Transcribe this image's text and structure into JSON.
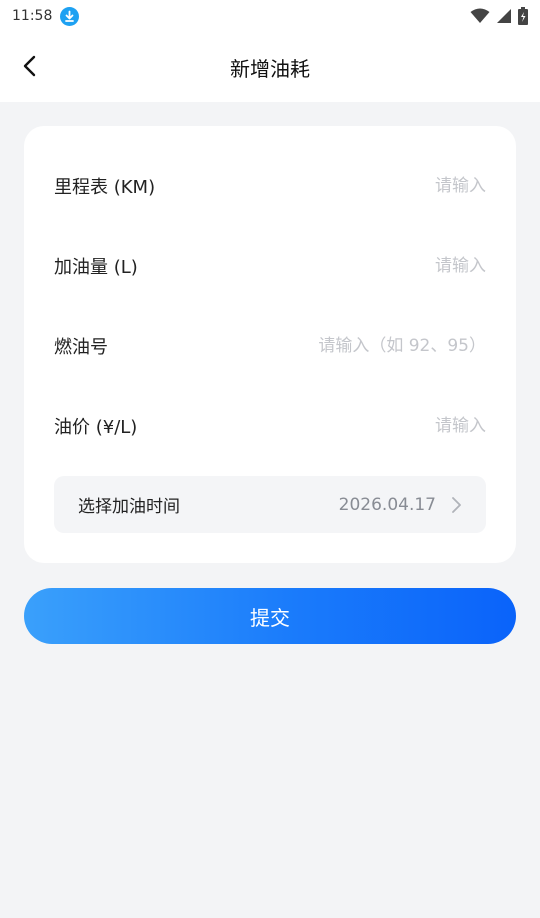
{
  "status_bar": {
    "time": "11:58",
    "icons": [
      "download-icon",
      "wifi-icon",
      "signal-icon",
      "battery-icon"
    ]
  },
  "header": {
    "title": "新增油耗",
    "back_icon": "chevron-left-icon"
  },
  "form": {
    "odometer": {
      "label": "里程表 (KM)",
      "placeholder": "请输入",
      "value": ""
    },
    "fuel_amount": {
      "label": "加油量 (L)",
      "placeholder": "请输入",
      "value": ""
    },
    "fuel_grade": {
      "label": "燃油号",
      "placeholder": "请输入（如 92、95）",
      "value": ""
    },
    "fuel_price": {
      "label": "油价 (¥/L)",
      "placeholder": "请输入",
      "value": ""
    },
    "refuel_time": {
      "label": "选择加油时间",
      "value": "2026.04.17"
    }
  },
  "submit_label": "提交",
  "colors": {
    "accent": "#1a7bfb",
    "gradient_start": "#3aa0fb",
    "gradient_end": "#0a63fa",
    "background": "#f3f4f6",
    "placeholder": "#c4c6cb"
  }
}
